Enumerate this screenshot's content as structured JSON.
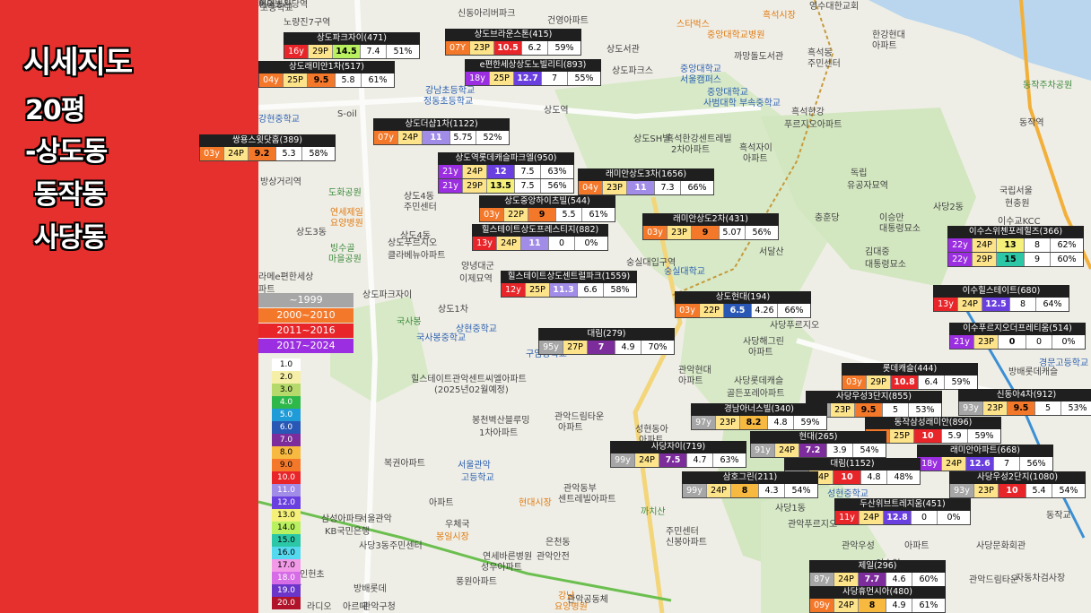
{
  "title": {
    "line1": "시세지도",
    "line2": "20평",
    "line3": "-상도동",
    "line4": "동작동",
    "line5": "사당동"
  },
  "colors": {
    "sidebar": "#e5302d",
    "y1999": "#a6a6a6",
    "y2000": "#f4782a",
    "y2011": "#e8262a",
    "y2017": "#9b2ee0"
  },
  "era_legend": [
    {
      "label": "~1999",
      "color": "#a6a6a6"
    },
    {
      "label": "2000~2010",
      "color": "#f4782a"
    },
    {
      "label": "2011~2016",
      "color": "#e8262a"
    },
    {
      "label": "2017~2024",
      "color": "#9b2ee0"
    }
  ],
  "price_legend": [
    {
      "label": "1.0",
      "bg": "#ffffff",
      "fg": "#000"
    },
    {
      "label": "2.0",
      "bg": "#f6efa8",
      "fg": "#000"
    },
    {
      "label": "3.0",
      "bg": "#b5d96b",
      "fg": "#000"
    },
    {
      "label": "4.0",
      "bg": "#2fb84a",
      "fg": "#fff"
    },
    {
      "label": "5.0",
      "bg": "#1f9cd8",
      "fg": "#fff"
    },
    {
      "label": "6.0",
      "bg": "#2857b5",
      "fg": "#fff"
    },
    {
      "label": "7.0",
      "bg": "#7d2c9c",
      "fg": "#fff"
    },
    {
      "label": "8.0",
      "bg": "#f7b940",
      "fg": "#000"
    },
    {
      "label": "9.0",
      "bg": "#f4782a",
      "fg": "#000"
    },
    {
      "label": "10.0",
      "bg": "#e8262a",
      "fg": "#fff"
    },
    {
      "label": "11.0",
      "bg": "#a18ce8",
      "fg": "#fff"
    },
    {
      "label": "12.0",
      "bg": "#6a3fe0",
      "fg": "#fff"
    },
    {
      "label": "13.0",
      "bg": "#f4f07a",
      "fg": "#000"
    },
    {
      "label": "14.0",
      "bg": "#b8f060",
      "fg": "#000"
    },
    {
      "label": "15.0",
      "bg": "#2bc7a6",
      "fg": "#000"
    },
    {
      "label": "16.0",
      "bg": "#55d9ef",
      "fg": "#000"
    },
    {
      "label": "17.0",
      "bg": "#f29ae8",
      "fg": "#000"
    },
    {
      "label": "18.0",
      "bg": "#d66ce6",
      "fg": "#fff"
    },
    {
      "label": "19.0",
      "bg": "#6b35c9",
      "fg": "#fff"
    },
    {
      "label": "20.0",
      "bg": "#b0132a",
      "fg": "#fff"
    }
  ],
  "map_labels": [
    {
      "t": "고등학교",
      "c": ""
    },
    {
      "t": "노량진7구역",
      "c": ""
    },
    {
      "t": "신동아리버파크",
      "c": ""
    },
    {
      "t": "건영아파트",
      "c": ""
    },
    {
      "t": "스타벅스",
      "c": "orange"
    },
    {
      "t": "흑석시장",
      "c": "orange"
    },
    {
      "t": "영수대한교회",
      "c": ""
    },
    {
      "t": "중앙대학교병원",
      "c": "orange"
    },
    {
      "t": "한강현대",
      "c": ""
    },
    {
      "t": "아파트",
      "c": ""
    },
    {
      "t": "까망돌도서관",
      "c": ""
    },
    {
      "t": "흑석동",
      "c": ""
    },
    {
      "t": "주민센터",
      "c": ""
    },
    {
      "t": "상도서관",
      "c": ""
    },
    {
      "t": "상도파크스",
      "c": ""
    },
    {
      "t": "중앙대학교",
      "c": "blue"
    },
    {
      "t": "서울캠퍼스",
      "c": "blue"
    },
    {
      "t": "중앙대학교",
      "c": "blue"
    },
    {
      "t": "사범대학 부속중학교",
      "c": "blue"
    },
    {
      "t": "흑석한강",
      "c": ""
    },
    {
      "t": "푸르지오아파트",
      "c": ""
    },
    {
      "t": "동작주차공원",
      "c": "green"
    },
    {
      "t": "동작역",
      "c": ""
    },
    {
      "t": "상도역",
      "c": ""
    },
    {
      "t": "강현중학교",
      "c": "blue"
    },
    {
      "t": "S-oil",
      "c": ""
    },
    {
      "t": "강남초등학교",
      "c": "blue"
    },
    {
      "t": "정동초등학교",
      "c": "blue"
    },
    {
      "t": "상도SH빌",
      "c": ""
    },
    {
      "t": "흑석한강센트레빌",
      "c": ""
    },
    {
      "t": "2차아파트",
      "c": ""
    },
    {
      "t": "흑석자이",
      "c": ""
    },
    {
      "t": "아파트",
      "c": ""
    },
    {
      "t": "방상거리역",
      "c": ""
    },
    {
      "t": "도화공원",
      "c": "green"
    },
    {
      "t": "상도4동",
      "c": ""
    },
    {
      "t": "주민센터",
      "c": ""
    },
    {
      "t": "연세제일",
      "c": "orange"
    },
    {
      "t": "요양병원",
      "c": "orange"
    },
    {
      "t": "국립서울",
      "c": ""
    },
    {
      "t": "현충원",
      "c": ""
    },
    {
      "t": "독립",
      "c": ""
    },
    {
      "t": "유공자묘역",
      "c": ""
    },
    {
      "t": "이승만",
      "c": ""
    },
    {
      "t": "대통령묘소",
      "c": ""
    },
    {
      "t": "충훈당",
      "c": ""
    },
    {
      "t": "사당2동",
      "c": ""
    },
    {
      "t": "이수교KCC",
      "c": ""
    },
    {
      "t": "상도3동",
      "c": ""
    },
    {
      "t": "빙수골",
      "c": "green"
    },
    {
      "t": "마을공원",
      "c": "green"
    },
    {
      "t": "상도4동",
      "c": ""
    },
    {
      "t": "상도푸르지오",
      "c": ""
    },
    {
      "t": "클라베뉴아파트",
      "c": ""
    },
    {
      "t": "양녕대군",
      "c": ""
    },
    {
      "t": "이제묘역",
      "c": ""
    },
    {
      "t": "숭실대입구역",
      "c": ""
    },
    {
      "t": "숭실대학교",
      "c": "blue"
    },
    {
      "t": "서달산",
      "c": ""
    },
    {
      "t": "김대중",
      "c": ""
    },
    {
      "t": "대통령묘소",
      "c": ""
    },
    {
      "t": "라메e편한세상",
      "c": ""
    },
    {
      "t": "파트",
      "c": ""
    },
    {
      "t": "남부중",
      "c": ""
    },
    {
      "t": "상도파크자이",
      "c": ""
    },
    {
      "t": "상도1차",
      "c": ""
    },
    {
      "t": "국사봉",
      "c": "green"
    },
    {
      "t": "국사봉중학교",
      "c": "blue"
    },
    {
      "t": "상현중학교",
      "c": "blue"
    },
    {
      "t": "사당푸르지오",
      "c": ""
    },
    {
      "t": "사당해그린",
      "c": ""
    },
    {
      "t": "아파트",
      "c": ""
    },
    {
      "t": "구암중학교",
      "c": "blue"
    },
    {
      "t": "관악현대",
      "c": ""
    },
    {
      "t": "아파트",
      "c": ""
    },
    {
      "t": "사당롯데캐슬",
      "c": ""
    },
    {
      "t": "골든포레아파트",
      "c": ""
    },
    {
      "t": "경문고등학교",
      "c": "blue"
    },
    {
      "t": "방배롯데캐슬",
      "c": ""
    },
    {
      "t": "힐스테이트관악센트씨엘아파트",
      "c": ""
    },
    {
      "t": "(2025년02월예정)",
      "c": ""
    },
    {
      "t": "관악드림타운",
      "c": ""
    },
    {
      "t": "아파트",
      "c": ""
    },
    {
      "t": "봉천벽산블루밍",
      "c": ""
    },
    {
      "t": "1차아파트",
      "c": ""
    },
    {
      "t": "성현동아",
      "c": ""
    },
    {
      "t": "아파트",
      "c": ""
    },
    {
      "t": "봉천",
      "c": ""
    },
    {
      "t": "우성아파트",
      "c": ""
    },
    {
      "t": "복권아파트",
      "c": ""
    },
    {
      "t": "서울관악",
      "c": "blue"
    },
    {
      "t": "고등학교",
      "c": "blue"
    },
    {
      "t": "관악동부",
      "c": ""
    },
    {
      "t": "센트레빌아파트",
      "c": ""
    },
    {
      "t": "현대시장",
      "c": "orange"
    },
    {
      "t": "관악푸르지오",
      "c": ""
    },
    {
      "t": "아파트",
      "c": ""
    },
    {
      "t": "까치산",
      "c": "green"
    },
    {
      "t": "삼성아파트",
      "c": ""
    },
    {
      "t": "KB국민은행",
      "c": ""
    },
    {
      "t": "서울관악",
      "c": ""
    },
    {
      "t": "우체국",
      "c": ""
    },
    {
      "t": "봉일시장",
      "c": "orange"
    },
    {
      "t": "은천동",
      "c": ""
    },
    {
      "t": "주민센터",
      "c": ""
    },
    {
      "t": "신봉아파트",
      "c": ""
    },
    {
      "t": "관악우성",
      "c": ""
    },
    {
      "t": "아파트",
      "c": ""
    },
    {
      "t": "사당문화회관",
      "c": ""
    },
    {
      "t": "사당3동주민센터",
      "c": ""
    },
    {
      "t": "연세바른병원",
      "c": ""
    },
    {
      "t": "성우아파트",
      "c": ""
    },
    {
      "t": "관악안전",
      "c": ""
    },
    {
      "t": "자동차검사장",
      "c": ""
    },
    {
      "t": "인헌초",
      "c": ""
    },
    {
      "t": "관악",
      "c": ""
    },
    {
      "t": "방배롯데",
      "c": ""
    },
    {
      "t": "아르떼",
      "c": ""
    },
    {
      "t": "관악구청",
      "c": ""
    },
    {
      "t": "풍원아파트",
      "c": ""
    },
    {
      "t": "강남",
      "c": "orange"
    },
    {
      "t": "요양병원",
      "c": "orange"
    },
    {
      "t": "봉천역",
      "c": ""
    },
    {
      "t": "관악공동체",
      "c": ""
    },
    {
      "t": "라디오",
      "c": ""
    },
    {
      "t": "관악센터",
      "c": ""
    },
    {
      "t": "관악드림타운",
      "c": ""
    },
    {
      "t": "건영4차",
      "c": ""
    },
    {
      "t": "동작교",
      "c": ""
    },
    {
      "t": "사당1동",
      "c": ""
    },
    {
      "t": "성현중학교",
      "c": "blue"
    },
    {
      "t": "이수역",
      "c": ""
    },
    {
      "t": "사당역",
      "c": ""
    },
    {
      "t": "이너스사당역",
      "c": ""
    },
    {
      "t": "제일병원",
      "c": ""
    },
    {
      "t": "현대",
      "c": ""
    }
  ],
  "complexes": [
    {
      "name": "상도파크자이(471)",
      "y": "16y",
      "ey": "r",
      "sz": "29P",
      "p1": "14.5",
      "p1c": "#b8f060",
      "p2": "7.4",
      "p2c": "#ffffff",
      "pc": "51%"
    },
    {
      "name": "상도브라운스톤(415)",
      "y": "07Y",
      "ey": "o",
      "sz": "23P",
      "p1": "10.5",
      "p1c": "#e8262a",
      "p2": "6.2",
      "p2c": "#ffffff",
      "pc": "59%"
    },
    {
      "name": "상도래미안1차(517)",
      "y": "04y",
      "ey": "o",
      "sz": "25P",
      "p1": "9.5",
      "p1c": "#f4782a",
      "p2": "5.8",
      "p2c": "#ffffff",
      "pc": "61%"
    },
    {
      "name": "e편한세상상도노빌리티(893)",
      "y": "18y",
      "ey": "p",
      "sz": "25P",
      "p1": "12.7",
      "p1c": "#6a3fe0",
      "p2": "7",
      "p2c": "#ffffff",
      "pc": "55%"
    },
    {
      "name": "상도더샵1차(1122)",
      "y": "07y",
      "ey": "o",
      "sz": "24P",
      "p1": "11",
      "p1c": "#a18ce8",
      "p2": "5.75",
      "p2c": "#ffffff",
      "pc": "52%"
    },
    {
      "name": "쌍용스윗닷홈(389)",
      "y": "03y",
      "ey": "o",
      "sz": "24P",
      "p1": "9.2",
      "p1c": "#f4782a",
      "p2": "5.3",
      "p2c": "#ffffff",
      "pc": "58%"
    },
    {
      "name": "상도역롯데캐슬파크엘(950)",
      "y": "21y",
      "ey": "p",
      "sz": "24P",
      "p1": "12",
      "p1c": "#6a3fe0",
      "p2": "7.5",
      "p2c": "#ffffff",
      "pc": "63%",
      "y2": "21y",
      "sz2": "29P",
      "p12": "13.5",
      "p12c": "#f4f07a",
      "p22": "7.5",
      "pc2": "56%"
    },
    {
      "name": "래미안상도3차(1656)",
      "y": "04y",
      "ey": "o",
      "sz": "23P",
      "p1": "11",
      "p1c": "#a18ce8",
      "p2": "7.3",
      "p2c": "#ffffff",
      "pc": "66%"
    },
    {
      "name": "상도중앙하이츠빌(544)",
      "y": "03y",
      "ey": "o",
      "sz": "22P",
      "p1": "9",
      "p1c": "#f4782a",
      "p2": "5.5",
      "p2c": "#ffffff",
      "pc": "61%"
    },
    {
      "name": "래미안상도2차(431)",
      "y": "03y",
      "ey": "o",
      "sz": "23P",
      "p1": "9",
      "p1c": "#f4782a",
      "p2": "5.07",
      "p2c": "#ffffff",
      "pc": "56%"
    },
    {
      "name": "힐스테이트상도프레스티지(882)",
      "y": "13y",
      "ey": "r",
      "sz": "24P",
      "p1": "11",
      "p1c": "#a18ce8",
      "p2": "0",
      "p2c": "#ffffff",
      "pc": "0%"
    },
    {
      "name": "이수스위첸포레힐즈(366)",
      "y": "22y",
      "ey": "p",
      "sz": "24P",
      "p1": "13",
      "p1c": "#f4f07a",
      "p2": "8",
      "p2c": "#ffffff",
      "pc": "62%",
      "y2": "22y",
      "sz2": "29P",
      "p12": "15",
      "p12c": "#2bc7a6",
      "p22": "9",
      "pc2": "60%"
    },
    {
      "name": "힐스테이트상도센트럴파크(1559)",
      "y": "12y",
      "ey": "r",
      "sz": "25P",
      "p1": "11.3",
      "p1c": "#a18ce8",
      "p2": "6.6",
      "p2c": "#ffffff",
      "pc": "58%"
    },
    {
      "name": "이수힐스테이트(680)",
      "y": "13y",
      "ey": "r",
      "sz": "24P",
      "p1": "12.5",
      "p1c": "#6a3fe0",
      "p2": "8",
      "p2c": "#ffffff",
      "pc": "64%"
    },
    {
      "name": "상도현대(194)",
      "y": "03y",
      "ey": "o",
      "sz": "22P",
      "p1": "6.5",
      "p1c": "#2857b5",
      "p2": "4.26",
      "p2c": "#ffffff",
      "pc": "66%"
    },
    {
      "name": "이수푸르지오더프레티움(514)",
      "y": "21y",
      "ey": "p",
      "sz": "23P",
      "p1": "0",
      "p1c": "#ffffff",
      "p2": "0",
      "p2c": "#ffffff",
      "pc": "0%"
    },
    {
      "name": "대림(279)",
      "y": "95y",
      "ey": "g",
      "sz": "27P",
      "p1": "7",
      "p1c": "#7d2c9c",
      "p2": "4.9",
      "p2c": "#ffffff",
      "pc": "70%"
    },
    {
      "name": "롯데캐슬(444)",
      "y": "03y",
      "ey": "o",
      "sz": "29P",
      "p1": "10.8",
      "p1c": "#e8262a",
      "p2": "6.4",
      "p2c": "#ffffff",
      "pc": "59%"
    },
    {
      "name": "사당우성3단지(855)",
      "y": "93y",
      "ey": "g",
      "sz": "23P",
      "p1": "9.5",
      "p1c": "#f4782a",
      "p2": "5",
      "p2c": "#ffffff",
      "pc": "53%"
    },
    {
      "name": "신동아4차(912)",
      "y": "93y",
      "ey": "g",
      "sz": "23P",
      "p1": "9.5",
      "p1c": "#f4782a",
      "p2": "5",
      "p2c": "#ffffff",
      "pc": "53%"
    },
    {
      "name": "경남아너스빌(340)",
      "y": "97y",
      "ey": "g",
      "sz": "23P",
      "p1": "8.2",
      "p1c": "#f7b940",
      "p2": "4.8",
      "p2c": "#ffffff",
      "pc": "59%"
    },
    {
      "name": "동작삼성래미안(896)",
      "y": "03y",
      "ey": "o",
      "sz": "25P",
      "p1": "10",
      "p1c": "#e8262a",
      "p2": "5.9",
      "p2c": "#ffffff",
      "pc": "59%"
    },
    {
      "name": "현대(265)",
      "y": "91y",
      "ey": "g",
      "sz": "24P",
      "p1": "7.2",
      "p1c": "#7d2c9c",
      "p2": "3.9",
      "p2c": "#ffffff",
      "pc": "54%"
    },
    {
      "name": "사당자이(719)",
      "y": "99y",
      "ey": "g",
      "sz": "24P",
      "p1": "7.5",
      "p1c": "#7d2c9c",
      "p2": "4.7",
      "p2c": "#ffffff",
      "pc": "63%"
    },
    {
      "name": "래미안아파트(668)",
      "y": "18y",
      "ey": "p",
      "sz": "24P",
      "p1": "12.6",
      "p1c": "#6a3fe0",
      "p2": "7",
      "p2c": "#ffffff",
      "pc": "56%"
    },
    {
      "name": "대림(1152)",
      "y": "90y",
      "ey": "g",
      "sz": "24P",
      "p1": "10",
      "p1c": "#e8262a",
      "p2": "4.8",
      "p2c": "#ffffff",
      "pc": "48%"
    },
    {
      "name": "삼호그린(211)",
      "y": "99y",
      "ey": "g",
      "sz": "24P",
      "p1": "8",
      "p1c": "#f7b940",
      "p2": "4.3",
      "p2c": "#ffffff",
      "pc": "54%"
    },
    {
      "name": "사당우성2단지(1080)",
      "y": "93y",
      "ey": "g",
      "sz": "23P",
      "p1": "10",
      "p1c": "#e8262a",
      "p2": "5.4",
      "p2c": "#ffffff",
      "pc": "54%"
    },
    {
      "name": "두산위브트레지움(451)",
      "y": "11y",
      "ey": "r",
      "sz": "24P",
      "p1": "12.8",
      "p1c": "#6a3fe0",
      "p2": "0",
      "p2c": "#ffffff",
      "pc": "0%"
    },
    {
      "name": "제일(296)",
      "y": "87y",
      "ey": "g",
      "sz": "24P",
      "p1": "7.7",
      "p1c": "#7d2c9c",
      "p2": "4.6",
      "p2c": "#ffffff",
      "pc": "60%"
    },
    {
      "name": "사당휴먼시아(480)",
      "y": "09y",
      "ey": "o",
      "sz": "24P",
      "p1": "8",
      "p1c": "#f7b940",
      "p2": "4.9",
      "p2c": "#ffffff",
      "pc": "61%"
    }
  ]
}
